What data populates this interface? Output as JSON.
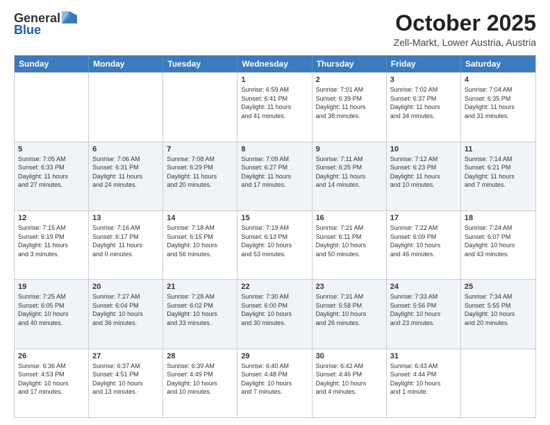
{
  "header": {
    "logo": {
      "line1": "General",
      "line2": "Blue"
    },
    "title": "October 2025",
    "location": "Zell-Markt, Lower Austria, Austria"
  },
  "weekdays": [
    "Sunday",
    "Monday",
    "Tuesday",
    "Wednesday",
    "Thursday",
    "Friday",
    "Saturday"
  ],
  "rows": [
    [
      {
        "day": "",
        "info": ""
      },
      {
        "day": "",
        "info": ""
      },
      {
        "day": "",
        "info": ""
      },
      {
        "day": "1",
        "info": "Sunrise: 6:59 AM\nSunset: 6:41 PM\nDaylight: 11 hours\nand 41 minutes."
      },
      {
        "day": "2",
        "info": "Sunrise: 7:01 AM\nSunset: 6:39 PM\nDaylight: 11 hours\nand 38 minutes."
      },
      {
        "day": "3",
        "info": "Sunrise: 7:02 AM\nSunset: 6:37 PM\nDaylight: 11 hours\nand 34 minutes."
      },
      {
        "day": "4",
        "info": "Sunrise: 7:04 AM\nSunset: 6:35 PM\nDaylight: 11 hours\nand 31 minutes."
      }
    ],
    [
      {
        "day": "5",
        "info": "Sunrise: 7:05 AM\nSunset: 6:33 PM\nDaylight: 11 hours\nand 27 minutes."
      },
      {
        "day": "6",
        "info": "Sunrise: 7:06 AM\nSunset: 6:31 PM\nDaylight: 11 hours\nand 24 minutes."
      },
      {
        "day": "7",
        "info": "Sunrise: 7:08 AM\nSunset: 6:29 PM\nDaylight: 11 hours\nand 20 minutes."
      },
      {
        "day": "8",
        "info": "Sunrise: 7:09 AM\nSunset: 6:27 PM\nDaylight: 11 hours\nand 17 minutes."
      },
      {
        "day": "9",
        "info": "Sunrise: 7:11 AM\nSunset: 6:25 PM\nDaylight: 11 hours\nand 14 minutes."
      },
      {
        "day": "10",
        "info": "Sunrise: 7:12 AM\nSunset: 6:23 PM\nDaylight: 11 hours\nand 10 minutes."
      },
      {
        "day": "11",
        "info": "Sunrise: 7:14 AM\nSunset: 6:21 PM\nDaylight: 11 hours\nand 7 minutes."
      }
    ],
    [
      {
        "day": "12",
        "info": "Sunrise: 7:15 AM\nSunset: 6:19 PM\nDaylight: 11 hours\nand 3 minutes."
      },
      {
        "day": "13",
        "info": "Sunrise: 7:16 AM\nSunset: 6:17 PM\nDaylight: 11 hours\nand 0 minutes."
      },
      {
        "day": "14",
        "info": "Sunrise: 7:18 AM\nSunset: 6:15 PM\nDaylight: 10 hours\nand 56 minutes."
      },
      {
        "day": "15",
        "info": "Sunrise: 7:19 AM\nSunset: 6:13 PM\nDaylight: 10 hours\nand 53 minutes."
      },
      {
        "day": "16",
        "info": "Sunrise: 7:21 AM\nSunset: 6:11 PM\nDaylight: 10 hours\nand 50 minutes."
      },
      {
        "day": "17",
        "info": "Sunrise: 7:22 AM\nSunset: 6:09 PM\nDaylight: 10 hours\nand 46 minutes."
      },
      {
        "day": "18",
        "info": "Sunrise: 7:24 AM\nSunset: 6:07 PM\nDaylight: 10 hours\nand 43 minutes."
      }
    ],
    [
      {
        "day": "19",
        "info": "Sunrise: 7:25 AM\nSunset: 6:05 PM\nDaylight: 10 hours\nand 40 minutes."
      },
      {
        "day": "20",
        "info": "Sunrise: 7:27 AM\nSunset: 6:04 PM\nDaylight: 10 hours\nand 36 minutes."
      },
      {
        "day": "21",
        "info": "Sunrise: 7:28 AM\nSunset: 6:02 PM\nDaylight: 10 hours\nand 33 minutes."
      },
      {
        "day": "22",
        "info": "Sunrise: 7:30 AM\nSunset: 6:00 PM\nDaylight: 10 hours\nand 30 minutes."
      },
      {
        "day": "23",
        "info": "Sunrise: 7:31 AM\nSunset: 5:58 PM\nDaylight: 10 hours\nand 26 minutes."
      },
      {
        "day": "24",
        "info": "Sunrise: 7:33 AM\nSunset: 5:56 PM\nDaylight: 10 hours\nand 23 minutes."
      },
      {
        "day": "25",
        "info": "Sunrise: 7:34 AM\nSunset: 5:55 PM\nDaylight: 10 hours\nand 20 minutes."
      }
    ],
    [
      {
        "day": "26",
        "info": "Sunrise: 6:36 AM\nSunset: 4:53 PM\nDaylight: 10 hours\nand 17 minutes."
      },
      {
        "day": "27",
        "info": "Sunrise: 6:37 AM\nSunset: 4:51 PM\nDaylight: 10 hours\nand 13 minutes."
      },
      {
        "day": "28",
        "info": "Sunrise: 6:39 AM\nSunset: 4:49 PM\nDaylight: 10 hours\nand 10 minutes."
      },
      {
        "day": "29",
        "info": "Sunrise: 6:40 AM\nSunset: 4:48 PM\nDaylight: 10 hours\nand 7 minutes."
      },
      {
        "day": "30",
        "info": "Sunrise: 6:42 AM\nSunset: 4:46 PM\nDaylight: 10 hours\nand 4 minutes."
      },
      {
        "day": "31",
        "info": "Sunrise: 6:43 AM\nSunset: 4:44 PM\nDaylight: 10 hours\nand 1 minute."
      },
      {
        "day": "",
        "info": ""
      }
    ]
  ]
}
